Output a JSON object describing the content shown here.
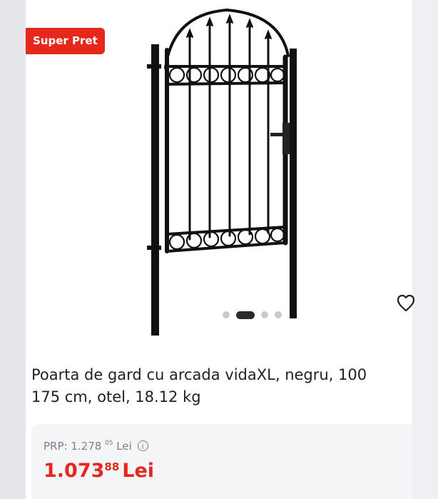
{
  "badge": {
    "label": "Super Pret",
    "color": "#e5281b"
  },
  "gallery": {
    "image_alt": "fence-gate-product-image",
    "dot_count": 4,
    "active_dot": 1
  },
  "favorite": {
    "icon": "heart-outline-icon"
  },
  "product": {
    "title_line1": "Poarta de gard cu arcada vidaXL, negru, 100",
    "title_line2": "175 cm, otel, 18.12 kg"
  },
  "pricing": {
    "prp_label": "PRP: 1.278",
    "prp_decimals": "05",
    "prp_currency": "Lei",
    "info_icon": "info-icon",
    "price_int": "1.073",
    "price_decimals": "88",
    "price_currency": "Lei",
    "accent_color": "#e5281b"
  }
}
